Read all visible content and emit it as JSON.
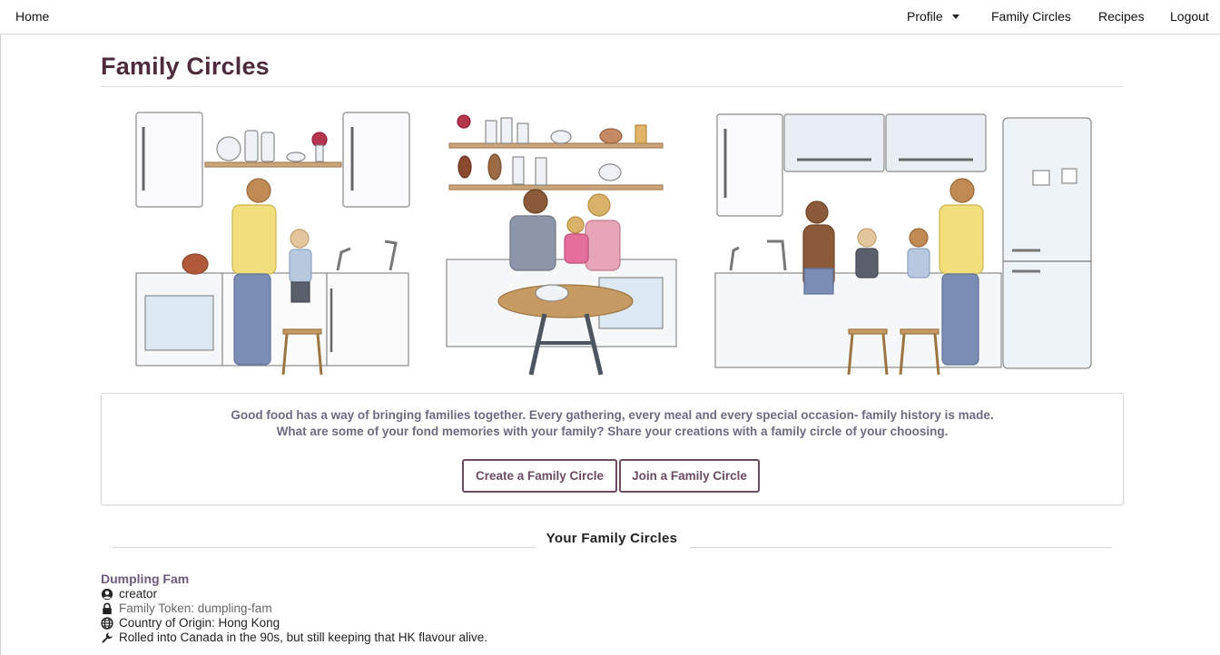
{
  "nav": {
    "home": "Home",
    "profile": "Profile",
    "family_circles": "Family Circles",
    "recipes": "Recipes",
    "logout": "Logout"
  },
  "page": {
    "title": "Family Circles"
  },
  "intro": {
    "line1": "Good food has a way of bringing families together. Every gathering, every meal and every special occasion- family history is made.",
    "line2": "What are some of your fond memories with your family? Share your creations with a family circle of your choosing.",
    "create_button": "Create a Family Circle",
    "join_button": "Join a Family Circle"
  },
  "circles_section": {
    "title": "Your Family Circles",
    "items": [
      {
        "name": "Dumpling Fam",
        "role": "creator",
        "token": "Family Token: dumpling-fam",
        "origin": "Country of Origin: Hong Kong",
        "description": "Rolled into Canada in the 90s, but still keeping that HK flavour alive."
      }
    ]
  },
  "icons": {
    "role": "user-circle-icon",
    "token": "lock-icon",
    "origin": "globe-icon",
    "description": "wrench-icon"
  },
  "colors": {
    "title": "#4e2a3d",
    "accent": "#6b4a62",
    "intro_text": "#6f6a80",
    "circle_name": "#6f5a7e"
  }
}
